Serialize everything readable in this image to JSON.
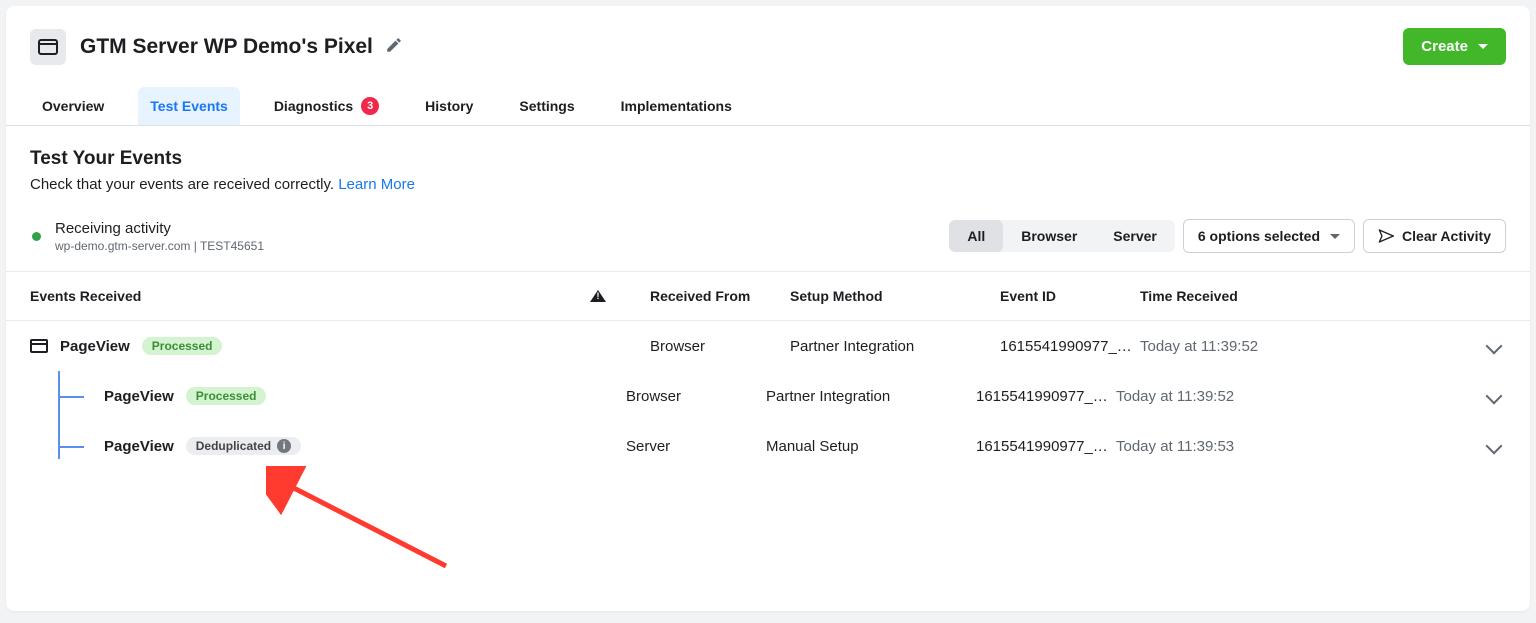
{
  "header": {
    "title": "GTM Server WP Demo's Pixel",
    "create_label": "Create"
  },
  "tabs": {
    "overview": "Overview",
    "test_events": "Test Events",
    "diagnostics": "Diagnostics",
    "diagnostics_badge": "3",
    "history": "History",
    "settings": "Settings",
    "implementations": "Implementations"
  },
  "intro": {
    "title": "Test Your Events",
    "subtitle": "Check that your events are received correctly. ",
    "link": "Learn More"
  },
  "activity": {
    "label": "Receiving activity",
    "domain": "wp-demo.gtm-server.com",
    "sep": "  |  ",
    "test_id": "TEST45651",
    "filter_all": "All",
    "filter_browser": "Browser",
    "filter_server": "Server",
    "options_label": "6 options selected",
    "clear_label": "Clear Activity"
  },
  "columns": {
    "events": "Events Received",
    "from": "Received From",
    "setup": "Setup Method",
    "eid": "Event ID",
    "time": "Time Received"
  },
  "pills": {
    "processed": "Processed",
    "deduplicated": "Deduplicated"
  },
  "events": {
    "parent": {
      "name": "PageView",
      "from": "Browser",
      "setup": "Partner Integration",
      "eid": "1615541990977_…",
      "time": "Today at 11:39:52"
    },
    "child1": {
      "name": "PageView",
      "from": "Browser",
      "setup": "Partner Integration",
      "eid": "1615541990977_…",
      "time": "Today at 11:39:52"
    },
    "child2": {
      "name": "PageView",
      "from": "Server",
      "setup": "Manual Setup",
      "eid": "1615541990977_…",
      "time": "Today at 11:39:53"
    }
  }
}
